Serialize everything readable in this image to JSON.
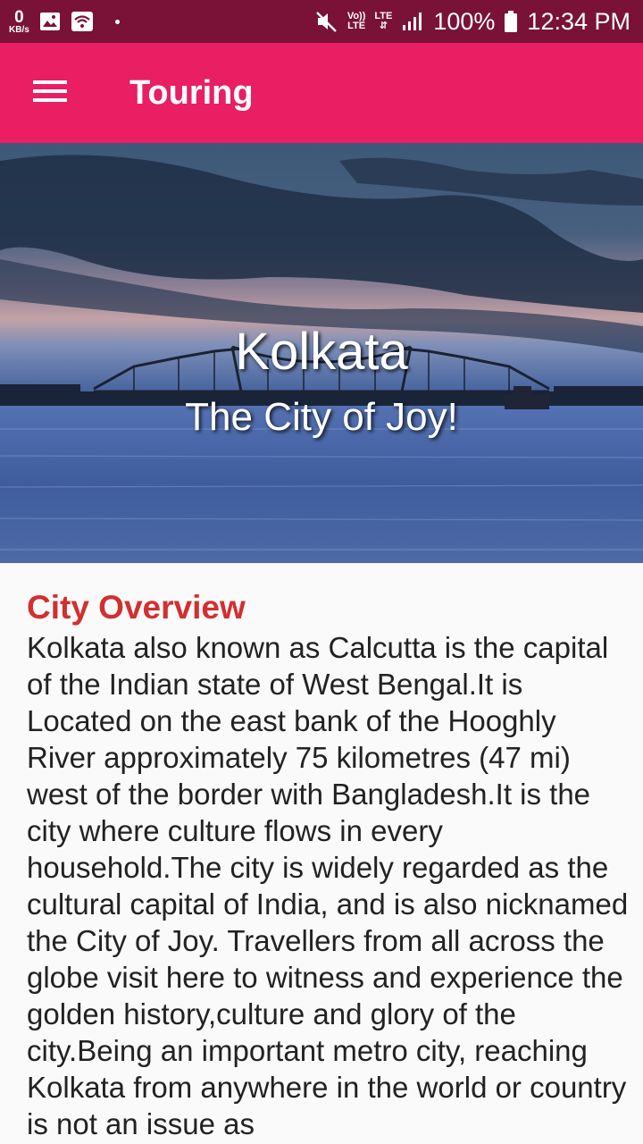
{
  "status_bar": {
    "speed_value": "0",
    "speed_unit": "KB/s",
    "network_label_top": "Vo))",
    "network_label_bottom": "LTE",
    "lte_label": "LTE",
    "battery_percent": "100%",
    "time": "12:34 PM",
    "icons": [
      "gallery-icon",
      "wifi-icon",
      "mute-icon",
      "signal-icon",
      "battery-icon"
    ]
  },
  "app_bar": {
    "title": "Touring",
    "color": "#e91e63"
  },
  "hero": {
    "title": "Kolkata",
    "subtitle": "The City of Joy!"
  },
  "overview": {
    "heading": "City Overview",
    "heading_color": "#d32f2f",
    "body": "Kolkata also known as Calcutta is the capital of the Indian state of West Bengal.It is Located on the east bank of the Hooghly River approximately 75 kilometres (47 mi) west of the border with Bangladesh.It is the city where culture flows in every household.The city is widely regarded as the cultural capital of India, and is also nicknamed the City of Joy. Travellers from all across the globe visit here to witness and experience the golden history,culture and glory of the city.Being an important metro city, reaching Kolkata from anywhere in the world or country is not an issue as"
  }
}
